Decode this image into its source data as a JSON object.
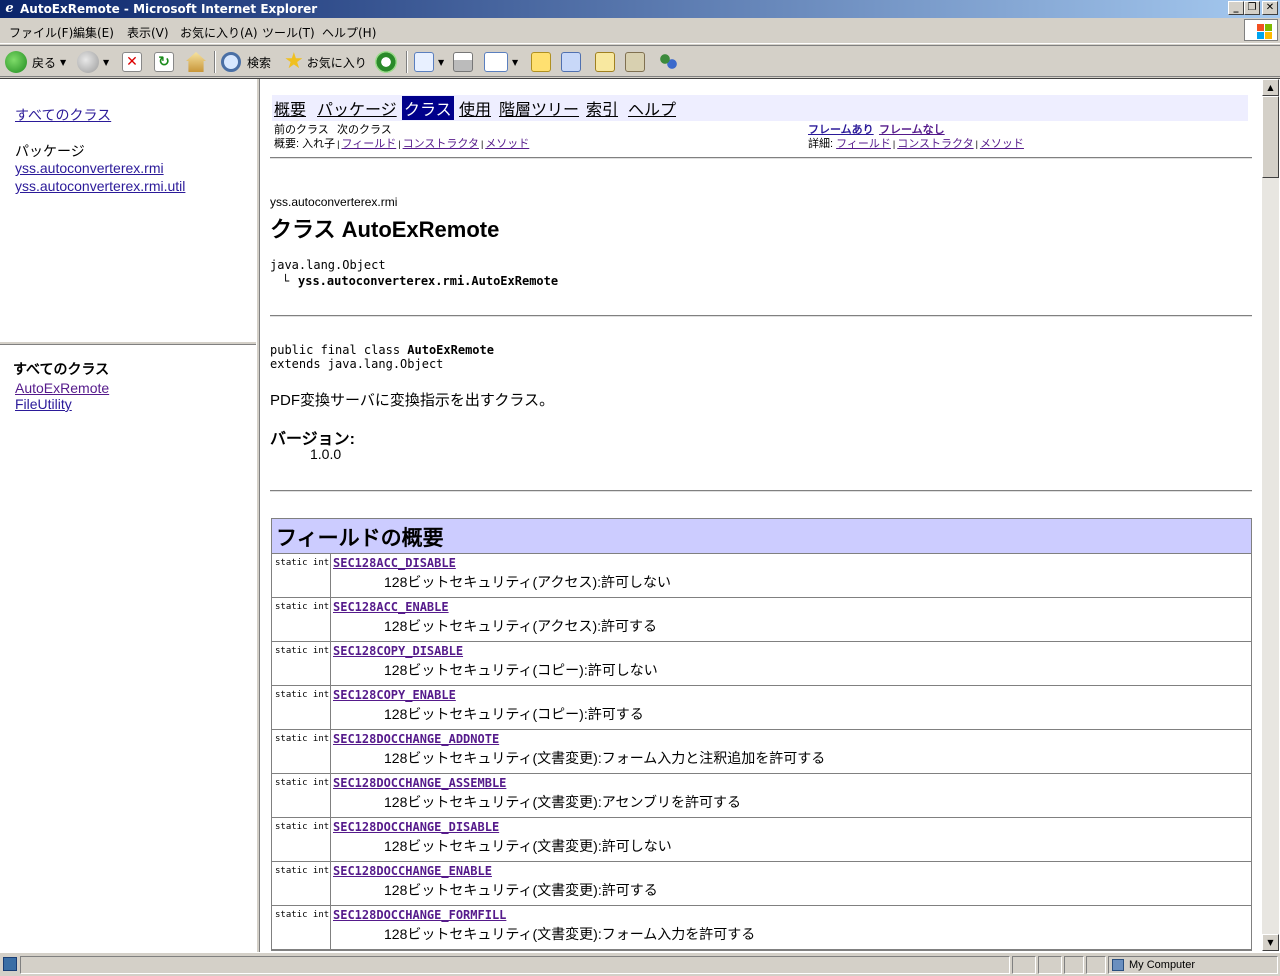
{
  "window": {
    "title": "AutoExRemote - Microsoft Internet Explorer",
    "minimize": "_",
    "restore": "❐",
    "close": "✕"
  },
  "menu": [
    "ファイル(F)",
    "編集(E)",
    "表示(V)",
    "お気に入り(A)",
    "ツール(T)",
    "ヘルプ(H)"
  ],
  "toolbar": {
    "back_label": "戻る",
    "search_label": "検索",
    "favorites_label": "お気に入り"
  },
  "left_top": {
    "all_classes_link": "すべてのクラス",
    "packages_heading": "パッケージ",
    "packages": [
      "yss.autoconverterex.rmi",
      "yss.autoconverterex.rmi.util"
    ]
  },
  "left_bottom": {
    "heading": "すべてのクラス",
    "classes": [
      "AutoExRemote",
      "FileUtility"
    ]
  },
  "nav": {
    "items": [
      "概要",
      "パッケージ",
      "クラス",
      "使用",
      "階層ツリー",
      "索引",
      "ヘルプ"
    ],
    "prev_class": "前のクラス",
    "next_class": "次のクラス",
    "frames": "フレームあり",
    "no_frames": "フレームなし",
    "summary_label": "概要:",
    "summary_nested": "入れ子",
    "summary_field": "フィールド",
    "summary_constructor": "コンストラクタ",
    "summary_method": "メソッド",
    "detail_label": "詳細:",
    "detail_field": "フィールド",
    "detail_constructor": "コンストラクタ",
    "detail_method": "メソッド",
    "separator": "|"
  },
  "class_header": {
    "package": "yss.autoconverterex.rmi",
    "title": "クラス AutoExRemote",
    "hierarchy_root": "java.lang.Object",
    "hierarchy_child_prefix": "└",
    "hierarchy_child": "yss.autoconverterex.rmi.AutoExRemote"
  },
  "declaration": {
    "prefix": "public final class ",
    "name": "AutoExRemote",
    "extends_line": "extends java.lang.Object",
    "description": "PDF変換サーバに変換指示を出すクラス。",
    "version_label": "バージョン:",
    "version_value": "1.0.0"
  },
  "field_summary": {
    "heading": "フィールドの概要",
    "rows": [
      {
        "type": "static int",
        "name": "SEC128ACC_DISABLE",
        "desc": "128ビットセキュリティ(アクセス):許可しない"
      },
      {
        "type": "static int",
        "name": "SEC128ACC_ENABLE",
        "desc": "128ビットセキュリティ(アクセス):許可する"
      },
      {
        "type": "static int",
        "name": "SEC128COPY_DISABLE",
        "desc": "128ビットセキュリティ(コピー):許可しない"
      },
      {
        "type": "static int",
        "name": "SEC128COPY_ENABLE",
        "desc": "128ビットセキュリティ(コピー):許可する"
      },
      {
        "type": "static int",
        "name": "SEC128DOCCHANGE_ADDNOTE",
        "desc": "128ビットセキュリティ(文書変更):フォーム入力と注釈追加を許可する"
      },
      {
        "type": "static int",
        "name": "SEC128DOCCHANGE_ASSEMBLE",
        "desc": "128ビットセキュリティ(文書変更):アセンブリを許可する"
      },
      {
        "type": "static int",
        "name": "SEC128DOCCHANGE_DISABLE",
        "desc": "128ビットセキュリティ(文書変更):許可しない"
      },
      {
        "type": "static int",
        "name": "SEC128DOCCHANGE_ENABLE",
        "desc": "128ビットセキュリティ(文書変更):許可する"
      },
      {
        "type": "static int",
        "name": "SEC128DOCCHANGE_FORMFILL",
        "desc": "128ビットセキュリティ(文書変更):フォーム入力を許可する"
      }
    ]
  },
  "statusbar": {
    "zone": "My Computer"
  },
  "colors": {
    "titlebar": "#0a246a",
    "nav_bg": "#eeeeff",
    "table_header": "#ccccff",
    "link": "#2b1a99",
    "visited": "#551a8b"
  }
}
